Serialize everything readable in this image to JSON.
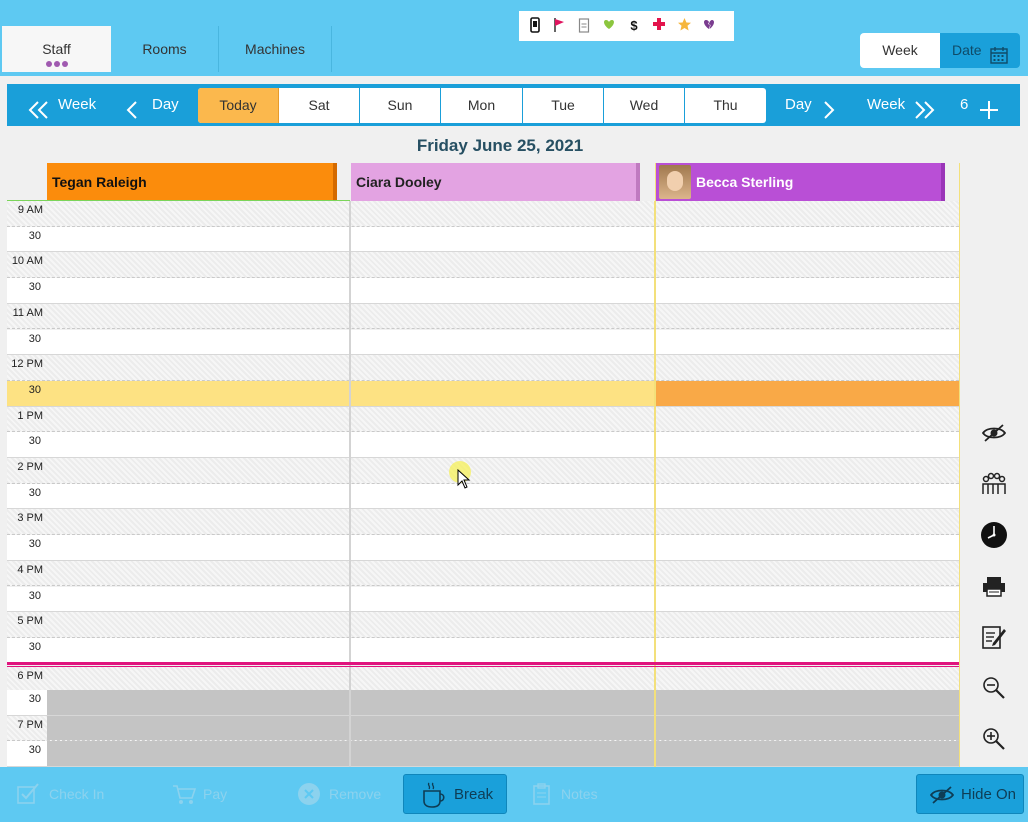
{
  "tabs": [
    {
      "label": "Staff",
      "active": true
    },
    {
      "label": "Rooms",
      "active": false
    },
    {
      "label": "Machines",
      "active": false
    }
  ],
  "filter_icons": [
    "phone-icon",
    "flag-icon",
    "clipboard-icon",
    "heart-icon",
    "dollar-icon",
    "cross-icon",
    "star-icon",
    "broken-heart-icon"
  ],
  "filter_glyphs": {
    "dollar": "$"
  },
  "view_switch": {
    "week_label": "Week",
    "date_label": "Date"
  },
  "nav": {
    "prev_week": "Week",
    "prev_day": "Day",
    "next_day": "Day",
    "next_week": "Week",
    "count": "6",
    "days": [
      "Today",
      "Sat",
      "Sun",
      "Mon",
      "Tue",
      "Wed",
      "Thu"
    ]
  },
  "date_title": "Friday June 25, 2021",
  "staff": [
    {
      "name": "Tegan Raleigh",
      "color": "#fb8c0c"
    },
    {
      "name": "Ciara Dooley",
      "color": "#e3a3e2"
    },
    {
      "name": "Becca Sterling",
      "color": "#b94fd6"
    }
  ],
  "time_labels": [
    "9 AM",
    "30",
    "10 AM",
    "30",
    "11 AM",
    "30",
    "12 PM",
    "30",
    "1 PM",
    "30",
    "2 PM",
    "30",
    "3 PM",
    "30",
    "4 PM",
    "30",
    "5 PM",
    "30",
    "6 PM",
    "30",
    "7 PM",
    "30"
  ],
  "tools": [
    "eye-icon",
    "group-icon",
    "clock-icon",
    "printer-icon",
    "notepad-icon",
    "zoom-out-icon",
    "zoom-in-icon"
  ],
  "bottom": {
    "check_in": "Check In",
    "pay": "Pay",
    "remove": "Remove",
    "break": "Break",
    "notes": "Notes",
    "hide_on": "Hide On"
  }
}
